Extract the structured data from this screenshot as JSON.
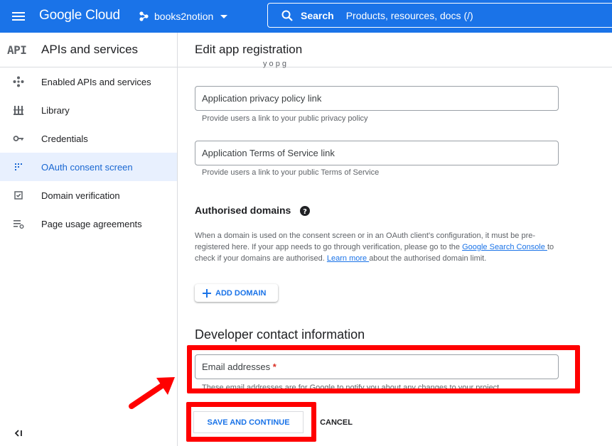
{
  "colors": {
    "brand_blue": "#1a73e8",
    "active_bg": "#e8f0fe",
    "highlight_red": "#ff0000"
  },
  "topbar": {
    "logo_google": "Google",
    "logo_cloud": "Cloud",
    "project_name": "books2notion",
    "search_label": "Search",
    "search_placeholder": "Products, resources, docs (/)"
  },
  "sidebar": {
    "logo_text": "API",
    "title": "APIs and services",
    "items": [
      {
        "label": "Enabled APIs and services",
        "icon": "hub-icon"
      },
      {
        "label": "Library",
        "icon": "library-icon"
      },
      {
        "label": "Credentials",
        "icon": "key-icon"
      },
      {
        "label": "OAuth consent screen",
        "icon": "consent-grid-icon",
        "active": true
      },
      {
        "label": "Domain verification",
        "icon": "checkbox-icon"
      },
      {
        "label": "Page usage agreements",
        "icon": "settings-list-icon"
      }
    ]
  },
  "main": {
    "title": "Edit app registration",
    "cut_text": "y  o   p  g",
    "privacy_placeholder": "Application privacy policy link",
    "privacy_hint": "Provide users a link to your public privacy policy",
    "tos_placeholder": "Application Terms of Service link",
    "tos_hint": "Provide users a link to your public Terms of Service",
    "auth_title": "Authorised domains",
    "auth_desc_1": "When a domain is used on the consent screen or in an OAuth client's configuration, it must be pre-registered here. If your app needs to go through verification, please go to the ",
    "auth_link_1": "Google Search Console ",
    "auth_desc_2": "to check if your domains are authorised. ",
    "auth_link_2": "Learn more ",
    "auth_desc_3": "about the authorised domain limit.",
    "add_domain": "ADD DOMAIN",
    "dev_title": "Developer contact information",
    "email_label": "Email addresses",
    "email_required": "*",
    "email_hint": "These email addresses are for Google to notify you about any changes to your project.",
    "save_button": "SAVE AND CONTINUE",
    "cancel_button": "CANCEL"
  }
}
